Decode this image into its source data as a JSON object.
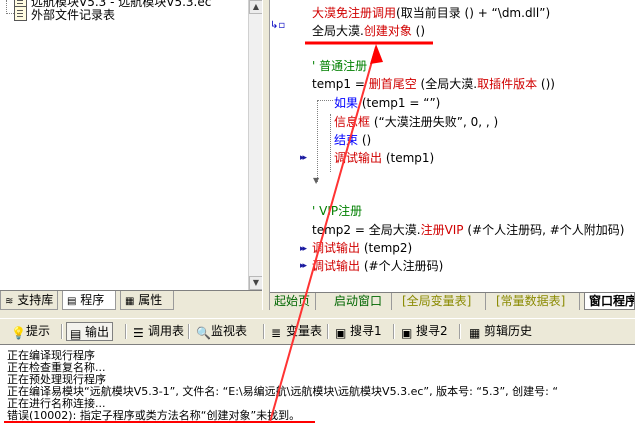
{
  "tree": {
    "items": [
      {
        "label": "远航模块V5.3 - 远航模块V5.3.ec"
      },
      {
        "label": "外部文件记录表"
      }
    ]
  },
  "left_tabs": [
    {
      "label": "支持库"
    },
    {
      "label": "程序"
    },
    {
      "label": "属性"
    }
  ],
  "code": {
    "line1": {
      "a": "大漠免注册调用",
      "b": "(取当前目录 () + “\\dm.dll”)"
    },
    "line2": {
      "a": "全局大漠",
      "b": ".",
      "c": "创建对象",
      "d": " ()"
    },
    "comment1": "' 普通注册",
    "line4": {
      "a": "temp1 = ",
      "b": "删首尾空",
      "c": " (全局大漠",
      "d": ".",
      "e": "取插件版本",
      "f": " ())"
    },
    "line5": {
      "a": "如果",
      "b": " (temp1 = “”)"
    },
    "line6": {
      "a": "信息框",
      "b": " (“大漠注册失败”, 0, , )"
    },
    "line7": {
      "a": "结束",
      "b": " ()"
    },
    "line8": {
      "a": "调试输出",
      "b": " (temp1)"
    },
    "comment2": "' VIP注册",
    "line10": {
      "a": "temp2 = ",
      "b": "全局大漠",
      "c": ".",
      "d": "注册VIP",
      "e": " (#个人注册码, #个人附加码)"
    },
    "line11": {
      "a": "调试输出",
      "b": " (temp2)"
    },
    "line12": {
      "a": "调试输出",
      "b": " (#个人注册码)"
    }
  },
  "editor_tabs": [
    {
      "label": "起始页"
    },
    {
      "label": "启动窗口"
    },
    {
      "label": "[全局变量表]"
    },
    {
      "label": "[常量数据表]"
    },
    {
      "label": "窗口程序"
    }
  ],
  "bottom_tabs": [
    {
      "label": "提示"
    },
    {
      "label": "输出"
    },
    {
      "label": "调用表"
    },
    {
      "label": "监视表"
    },
    {
      "label": "变量表"
    },
    {
      "label": "搜寻1"
    },
    {
      "label": "搜寻2"
    },
    {
      "label": "剪辑历史"
    }
  ],
  "output": {
    "lines": [
      "正在编译现行程序",
      "正在检查重复名称...",
      "正在预处理现行程序",
      "正在编译易模块“远航模块V5.3-1”, 文件名: “E:\\易编远航\\远航模块\\远航模块V5.3.ec”, 版本号: “5.3”, 创建号: “",
      "正在进行名称连接...",
      "错误(10002): 指定子程序或类方法名称“创建对象”未找到。"
    ]
  },
  "colors": {
    "annotation": "#ff0000",
    "keyword_blue": "#0000ff",
    "function_red": "#d00000",
    "comment_green": "#008000"
  }
}
